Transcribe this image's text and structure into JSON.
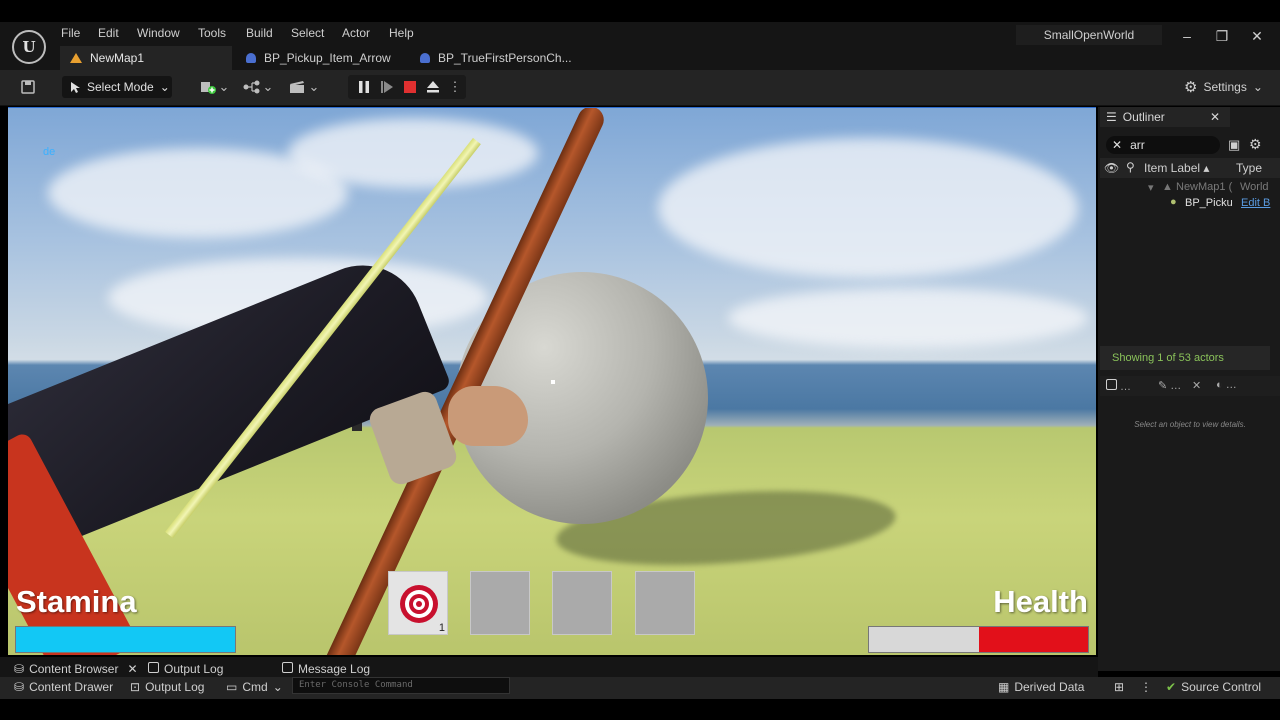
{
  "menu": {
    "items": [
      "File",
      "Edit",
      "Window",
      "Tools",
      "Build",
      "Select",
      "Actor",
      "Help"
    ]
  },
  "logo": {
    "text": "U"
  },
  "tabs": [
    {
      "label": "NewMap1",
      "active": true
    },
    {
      "label": "BP_Pickup_Item_Arrow",
      "active": false
    },
    {
      "label": "BP_TrueFirstPersonCh...",
      "active": false
    }
  ],
  "project": {
    "name": "SmallOpenWorld"
  },
  "window_controls": {
    "minimize": "–",
    "restore": "❐",
    "close": "✕"
  },
  "toolbar": {
    "select_mode": "Select Mode",
    "settings": "Settings"
  },
  "viewport": {
    "debug_text": "de"
  },
  "hud": {
    "stamina_label": "Stamina",
    "stamina_fraction": 1.0,
    "health_label": "Health",
    "health_fraction": 0.5,
    "slot_count": "1",
    "stamina_color": "#12c8f5",
    "health_color": "#e2101a"
  },
  "outliner": {
    "title": "Outliner",
    "search_value": "arr",
    "col_label": "Item Label",
    "col_type": "Type",
    "rows": [
      {
        "label": "NewMap1 (",
        "type": "World"
      },
      {
        "label": "BP_Picku",
        "type": "Edit B"
      }
    ],
    "showing": "Showing 1 of 53 actors",
    "details_empty": "Select an object to view details."
  },
  "bottom": {
    "content_browser": "Content Browser",
    "output_log_tab": "Output Log",
    "message_log": "Message Log",
    "content_drawer": "Content Drawer",
    "output_log": "Output Log",
    "cmd": "Cmd",
    "console_placeholder": "Enter Console Command",
    "derived_data": "Derived Data",
    "source_control": "Source Control"
  },
  "colors": {
    "accent": "#2d6cd0",
    "status_green": "#8ac25a"
  }
}
